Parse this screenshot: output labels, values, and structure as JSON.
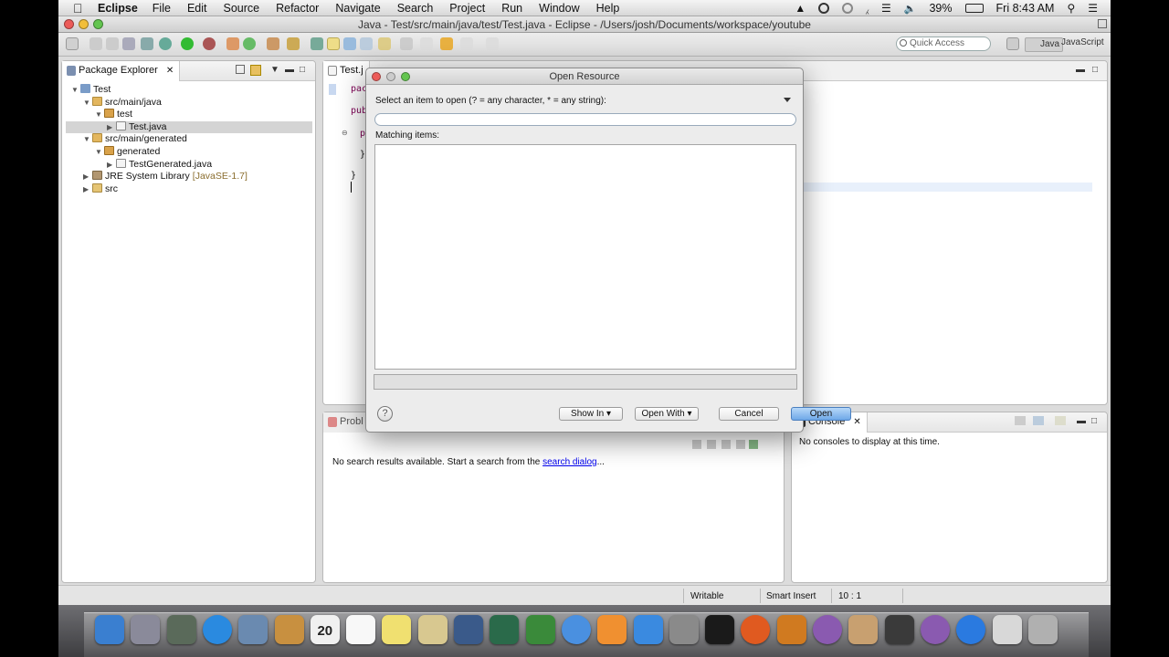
{
  "menubar": {
    "app": "Eclipse",
    "menus": [
      "File",
      "Edit",
      "Source",
      "Refactor",
      "Navigate",
      "Search",
      "Project",
      "Run",
      "Window",
      "Help"
    ],
    "battery": "39%",
    "clock": "Fri 8:43 AM"
  },
  "window": {
    "title": "Java - Test/src/main/java/test/Test.java - Eclipse - /Users/josh/Documents/workspace/youtube"
  },
  "toolbar": {
    "quick_access_placeholder": "Quick Access",
    "perspectives": [
      "Java",
      "JavaScript"
    ]
  },
  "package_explorer": {
    "tab_label": "Package Explorer",
    "tree": [
      {
        "label": "Test",
        "icon": "project-icon",
        "depth": 0,
        "expanded": true
      },
      {
        "label": "src/main/java",
        "icon": "source-folder-icon",
        "depth": 1,
        "expanded": true
      },
      {
        "label": "test",
        "icon": "package-icon",
        "depth": 2,
        "expanded": true
      },
      {
        "label": "Test.java",
        "icon": "java-file-icon",
        "depth": 3,
        "expanded": false,
        "selected": true
      },
      {
        "label": "src/main/generated",
        "icon": "source-folder-icon",
        "depth": 1,
        "expanded": true
      },
      {
        "label": "generated",
        "icon": "package-icon",
        "depth": 2,
        "expanded": true
      },
      {
        "label": "TestGenerated.java",
        "icon": "java-file-icon",
        "depth": 3,
        "expanded": false
      },
      {
        "label": "JRE System Library",
        "suffix": "[JavaSE-1.7]",
        "icon": "library-icon",
        "depth": 1,
        "expanded": false
      },
      {
        "label": "src",
        "icon": "folder-icon",
        "depth": 1,
        "expanded": false
      }
    ]
  },
  "editor": {
    "tab_label": "Test.j",
    "code_fragments": [
      "pac",
      "pub",
      "p",
      "}",
      "}"
    ]
  },
  "problems": {
    "tab_label": "Probl",
    "message": "No search results available. Start a search from the",
    "link": "search dialog",
    "ellipsis": "..."
  },
  "console": {
    "tab_label": "Console",
    "message": "No consoles to display at this time."
  },
  "statusbar": {
    "mode": "Writable",
    "insert": "Smart Insert",
    "position": "10 : 1"
  },
  "dialog": {
    "title": "Open Resource",
    "prompt": "Select an item to open (? = any character, * = any string):",
    "input_value": "",
    "matching_label": "Matching items:",
    "buttons": {
      "show_in": "Show In ▾",
      "open_with": "Open With ▾",
      "cancel": "Cancel",
      "open": "Open"
    },
    "help": "?"
  },
  "colors": {
    "link": "#0000ee",
    "keyword": "#7f0055",
    "primary_button": "#6fa8e8"
  },
  "dock": {
    "icons": [
      "finder-icon",
      "launchpad-icon",
      "photo-booth-icon",
      "safari-icon",
      "preview-icon",
      "mail-icon",
      "calendar-icon",
      "reminders-icon",
      "notes-icon",
      "contacts-icon",
      "facetime-icon",
      "photos-icon",
      "iphoto-icon",
      "itunes-icon",
      "ibooks-icon",
      "app-store-icon",
      "system-preferences-icon",
      "terminal-icon",
      "firefox-icon",
      "sublime-icon",
      "eclipse-icon",
      "user-icon",
      "camera-icon",
      "eclipse2-icon",
      "quicktime-icon",
      "documents-icon",
      "trash-icon"
    ],
    "calendar_day": "20"
  }
}
